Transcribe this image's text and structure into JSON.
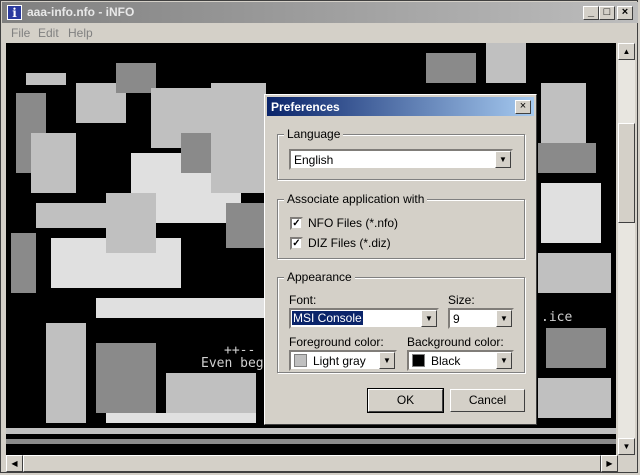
{
  "window": {
    "title": "aaa-info.nfo - iNFO",
    "app_icon": "info-i-icon",
    "controls": {
      "minimize": "_",
      "maximize": "□",
      "close": "×"
    }
  },
  "menu": [
    "File",
    "Edit",
    "Help"
  ],
  "nfo_art": {
    "line1": "++--",
    "line2": "Even beg",
    "tail": ".ice"
  },
  "preferences": {
    "title": "Preferences",
    "close": "×",
    "language": {
      "legend": "Language",
      "value": "English"
    },
    "associate": {
      "legend": "Associate application with",
      "nfo_label": "NFO Files (*.nfo)",
      "nfo_checked": true,
      "diz_label": "DIZ Files (*.diz)",
      "diz_checked": true
    },
    "appearance": {
      "legend": "Appearance",
      "font_label": "Font:",
      "font_value": "MSI Console",
      "size_label": "Size:",
      "size_value": "9",
      "fg_label": "Foreground color:",
      "fg_value": "Light gray",
      "fg_color": "#c0c0c0",
      "bg_label": "Background color:",
      "bg_value": "Black",
      "bg_color": "#000000"
    },
    "ok": "OK",
    "cancel": "Cancel"
  },
  "check_glyph": "✓",
  "arrow_glyph": "▼"
}
